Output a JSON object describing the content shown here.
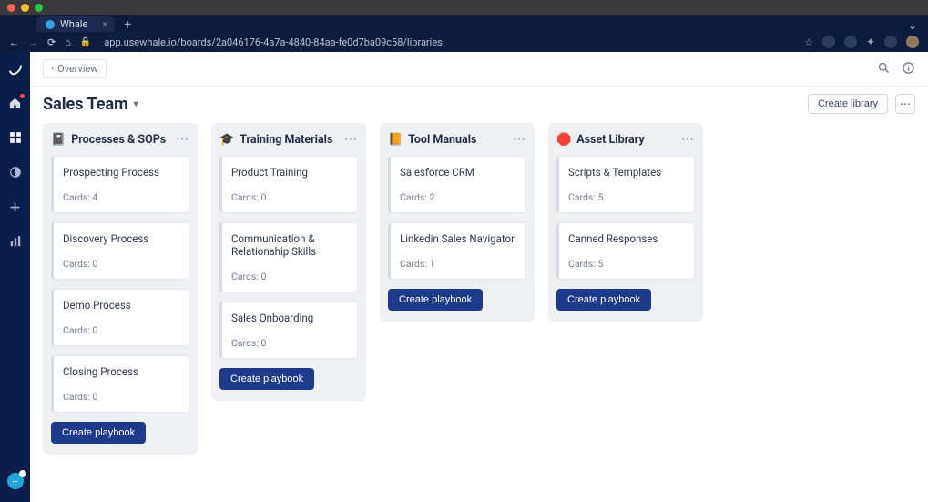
{
  "browser": {
    "tab_title": "Whale",
    "url": "app.usewhale.io/boards/2a046176-4a7a-4840-84aa-fe0d7ba09c58/libraries",
    "chevron_down": "⌄"
  },
  "topbar": {
    "back_label": "Overview"
  },
  "page": {
    "title": "Sales Team"
  },
  "actions": {
    "create_library": "Create library"
  },
  "columns": [
    {
      "emoji": "📓",
      "title": "Processes & SOPs",
      "create_label": "Create playbook",
      "cards_prefix": "Cards: ",
      "cards": [
        {
          "title": "Prospecting Process",
          "count": "4"
        },
        {
          "title": "Discovery Process",
          "count": "0"
        },
        {
          "title": "Demo Process",
          "count": "0"
        },
        {
          "title": "Closing Process",
          "count": "0"
        }
      ]
    },
    {
      "emoji": "🎓",
      "title": "Training Materials",
      "create_label": "Create playbook",
      "cards_prefix": "Cards: ",
      "cards": [
        {
          "title": "Product Training",
          "count": "0"
        },
        {
          "title": "Communication & Relationship Skills",
          "count": "0"
        },
        {
          "title": "Sales Onboarding",
          "count": "0"
        }
      ]
    },
    {
      "emoji": "📙",
      "title": "Tool Manuals",
      "create_label": "Create playbook",
      "cards_prefix": "Cards: ",
      "cards": [
        {
          "title": "Salesforce CRM",
          "count": "2"
        },
        {
          "title": "Linkedin Sales Navigator",
          "count": "1"
        }
      ]
    },
    {
      "emoji": "🛑",
      "title": "Asset Library",
      "create_label": "Create playbook",
      "cards_prefix": "Cards: ",
      "cards": [
        {
          "title": "Scripts & Templates",
          "count": "5"
        },
        {
          "title": "Canned Responses",
          "count": "5"
        }
      ]
    }
  ]
}
